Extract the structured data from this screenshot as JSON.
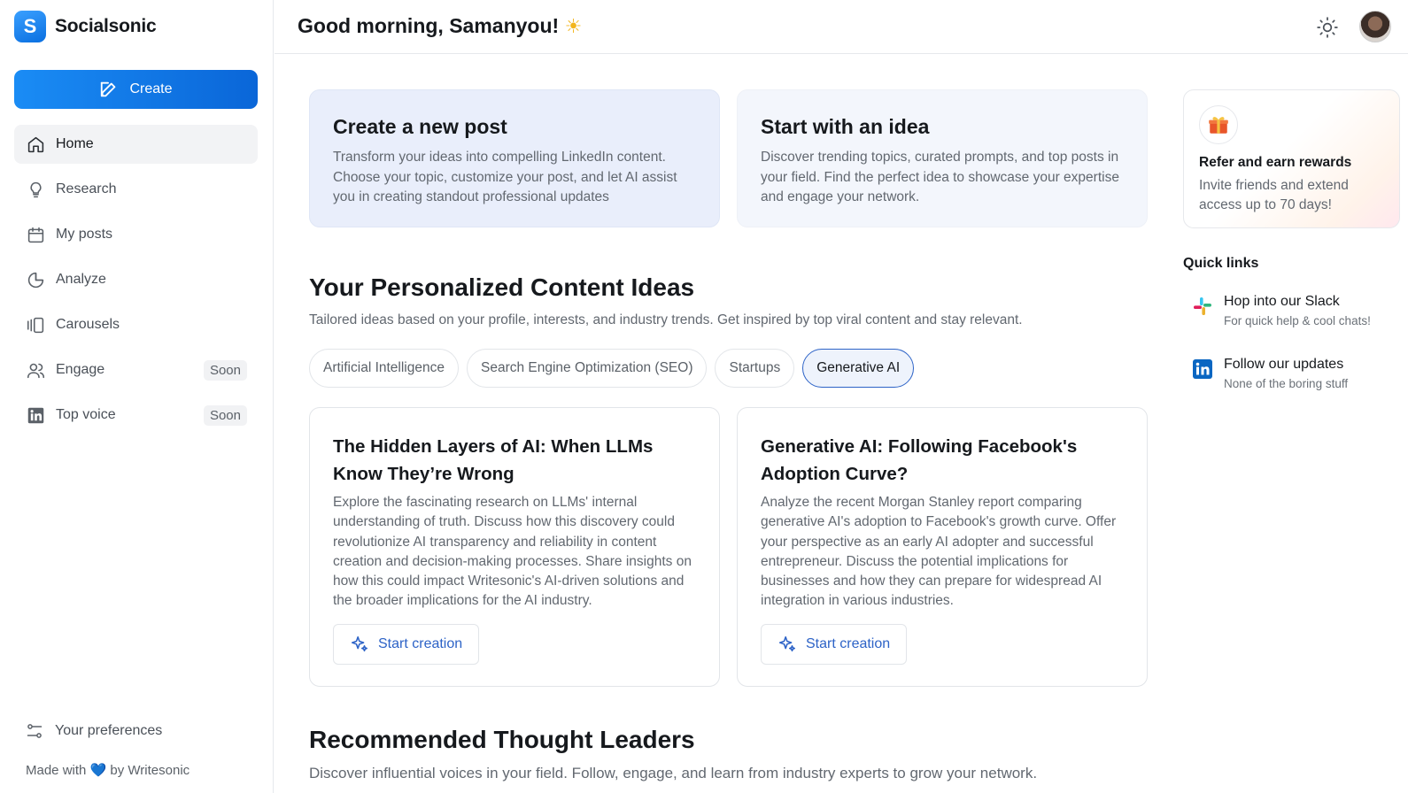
{
  "brand": {
    "name": "Socialsonic",
    "logo_glyph": "S"
  },
  "sidebar": {
    "create_label": "Create",
    "items": [
      {
        "label": "Home",
        "icon": "home-icon",
        "active": true
      },
      {
        "label": "Research",
        "icon": "lightbulb-icon"
      },
      {
        "label": "My posts",
        "icon": "calendar-icon"
      },
      {
        "label": "Analyze",
        "icon": "pie-chart-icon"
      },
      {
        "label": "Carousels",
        "icon": "carousel-icon"
      },
      {
        "label": "Engage",
        "icon": "users-icon",
        "badge": "Soon"
      },
      {
        "label": "Top voice",
        "icon": "linkedin-icon",
        "badge": "Soon"
      }
    ],
    "preferences_label": "Your preferences",
    "footer": {
      "prefix": "Made with",
      "heart": "💙",
      "suffix": "by Writesonic"
    }
  },
  "header": {
    "greeting": "Good morning, Samanyou!",
    "emoji": "☀"
  },
  "top_cards": [
    {
      "title": "Create a new post",
      "body": "Transform your ideas into compelling LinkedIn content. Choose your topic, customize your post, and let AI assist you in creating standout professional updates"
    },
    {
      "title": "Start with an idea",
      "body": "Discover trending topics, curated prompts, and top posts in your field. Find the perfect idea to showcase your expertise and engage your network."
    }
  ],
  "ideas_section": {
    "title": "Your Personalized Content Ideas",
    "subtitle": "Tailored ideas based on your profile, interests, and industry trends. Get inspired by top viral content and stay relevant.",
    "topics": [
      "Artificial Intelligence",
      "Search Engine Optimization (SEO)",
      "Startups",
      "Generative AI"
    ],
    "selected_topic": "Generative AI",
    "cards": [
      {
        "title": "The Hidden Layers of AI: When LLMs Know They’re Wrong",
        "body": "Explore the fascinating research on LLMs' internal understanding of truth. Discuss how this discovery could revolutionize AI transparency and reliability in content creation and decision-making processes. Share insights on how this could impact Writesonic's AI-driven solutions and the broader implications for the AI industry.",
        "button": "Start creation"
      },
      {
        "title": "Generative AI: Following Facebook's Adoption Curve?",
        "body": "Analyze the recent Morgan Stanley report comparing generative AI's adoption to Facebook's growth curve. Offer your perspective as an early AI adopter and successful entrepreneur. Discuss the potential implications for businesses and how they can prepare for widespread AI integration in various industries.",
        "button": "Start creation"
      }
    ]
  },
  "leaders_section": {
    "title": "Recommended Thought Leaders",
    "subtitle": "Discover influential voices in your field. Follow, engage, and learn from industry experts to grow your network."
  },
  "refer": {
    "title": "Refer and earn rewards",
    "body": "Invite friends and extend access up to 70 days!",
    "icon": "gift-icon"
  },
  "quick_links": {
    "title": "Quick links",
    "items": [
      {
        "title": "Hop into our Slack",
        "subtitle": "For quick help & cool chats!",
        "icon": "slack-icon"
      },
      {
        "title": "Follow our updates",
        "subtitle": "None of the boring stuff",
        "icon": "linkedin-icon"
      }
    ]
  },
  "colors": {
    "accent": "#0a66d8",
    "selected_chip_border": "#2d63c7",
    "linkedin": "#0a66c2"
  }
}
